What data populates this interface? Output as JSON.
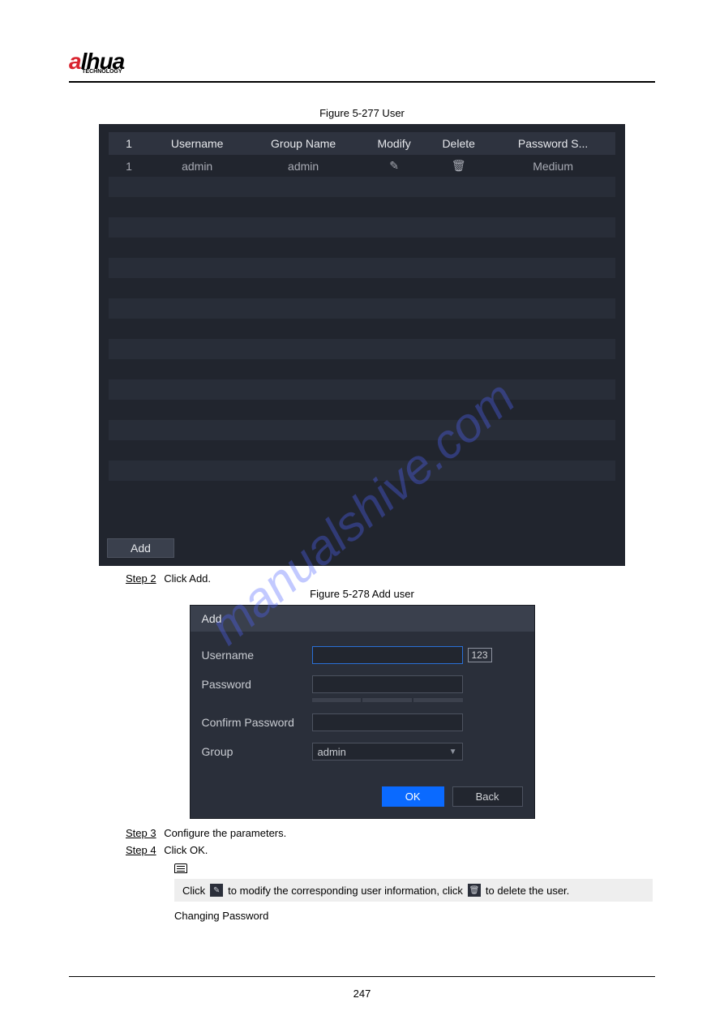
{
  "logo": {
    "brand": "alhua",
    "sub": "TECHNOLOGY"
  },
  "figure1": {
    "caption": "Figure 5-277 User"
  },
  "table": {
    "headers": [
      "1",
      "Username",
      "Group Name",
      "Modify",
      "Delete",
      "Password S..."
    ],
    "rows": [
      {
        "idx": "1",
        "username": "admin",
        "group": "admin",
        "strength": "Medium"
      }
    ],
    "add_label": "Add"
  },
  "watermark": "manualshive.com",
  "step2": {
    "label": "Step 2",
    "text": "Click Add."
  },
  "figure2": {
    "caption": "Figure 5-278 Add user"
  },
  "dialog": {
    "title": "Add",
    "username_label": "Username",
    "password_label": "Password",
    "confirm_label": "Confirm Password",
    "group_label": "Group",
    "group_value": "admin",
    "badge": "123",
    "ok": "OK",
    "back": "Back"
  },
  "step3": {
    "label": "Step 3",
    "text": "Configure the parameters."
  },
  "step4": {
    "label": "Step 4",
    "text": "Click OK."
  },
  "note": {
    "prefix": "Click",
    "mid": "to modify the corresponding user information, click",
    "suffix": "to delete the user."
  },
  "footer": {
    "title": "Changing Password",
    "page": "247"
  }
}
